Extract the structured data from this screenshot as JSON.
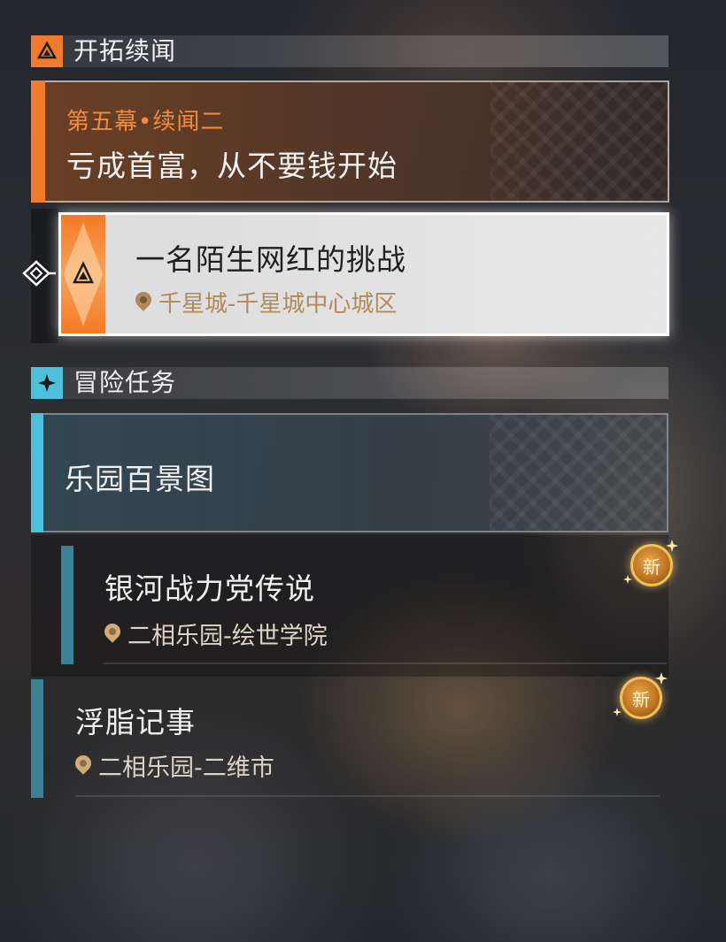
{
  "trailblaze": {
    "section_title": "开拓续闻",
    "section_icon": "triangle-emblem-icon",
    "accent_color": "#f07b2e",
    "chapter": {
      "subtitle": "第五幕•续闻二",
      "title": "亏成首富，从不要钱开始"
    },
    "selected_mission": {
      "title": "一名陌生网红的挑战",
      "location": "千星城-千星城中心城区",
      "icon": "trailblaze-mission-icon"
    }
  },
  "adventure": {
    "section_title": "冒险任务",
    "section_icon": "four-point-star-icon",
    "accent_color": "#4fc0dc",
    "group": {
      "title": "乐园百景图"
    },
    "missions": [
      {
        "title": "银河战力党传说",
        "location": "二相乐园-绘世学院",
        "badge": "新"
      },
      {
        "title": "浮脂记事",
        "location": "二相乐园-二维市",
        "badge": "新"
      }
    ]
  }
}
